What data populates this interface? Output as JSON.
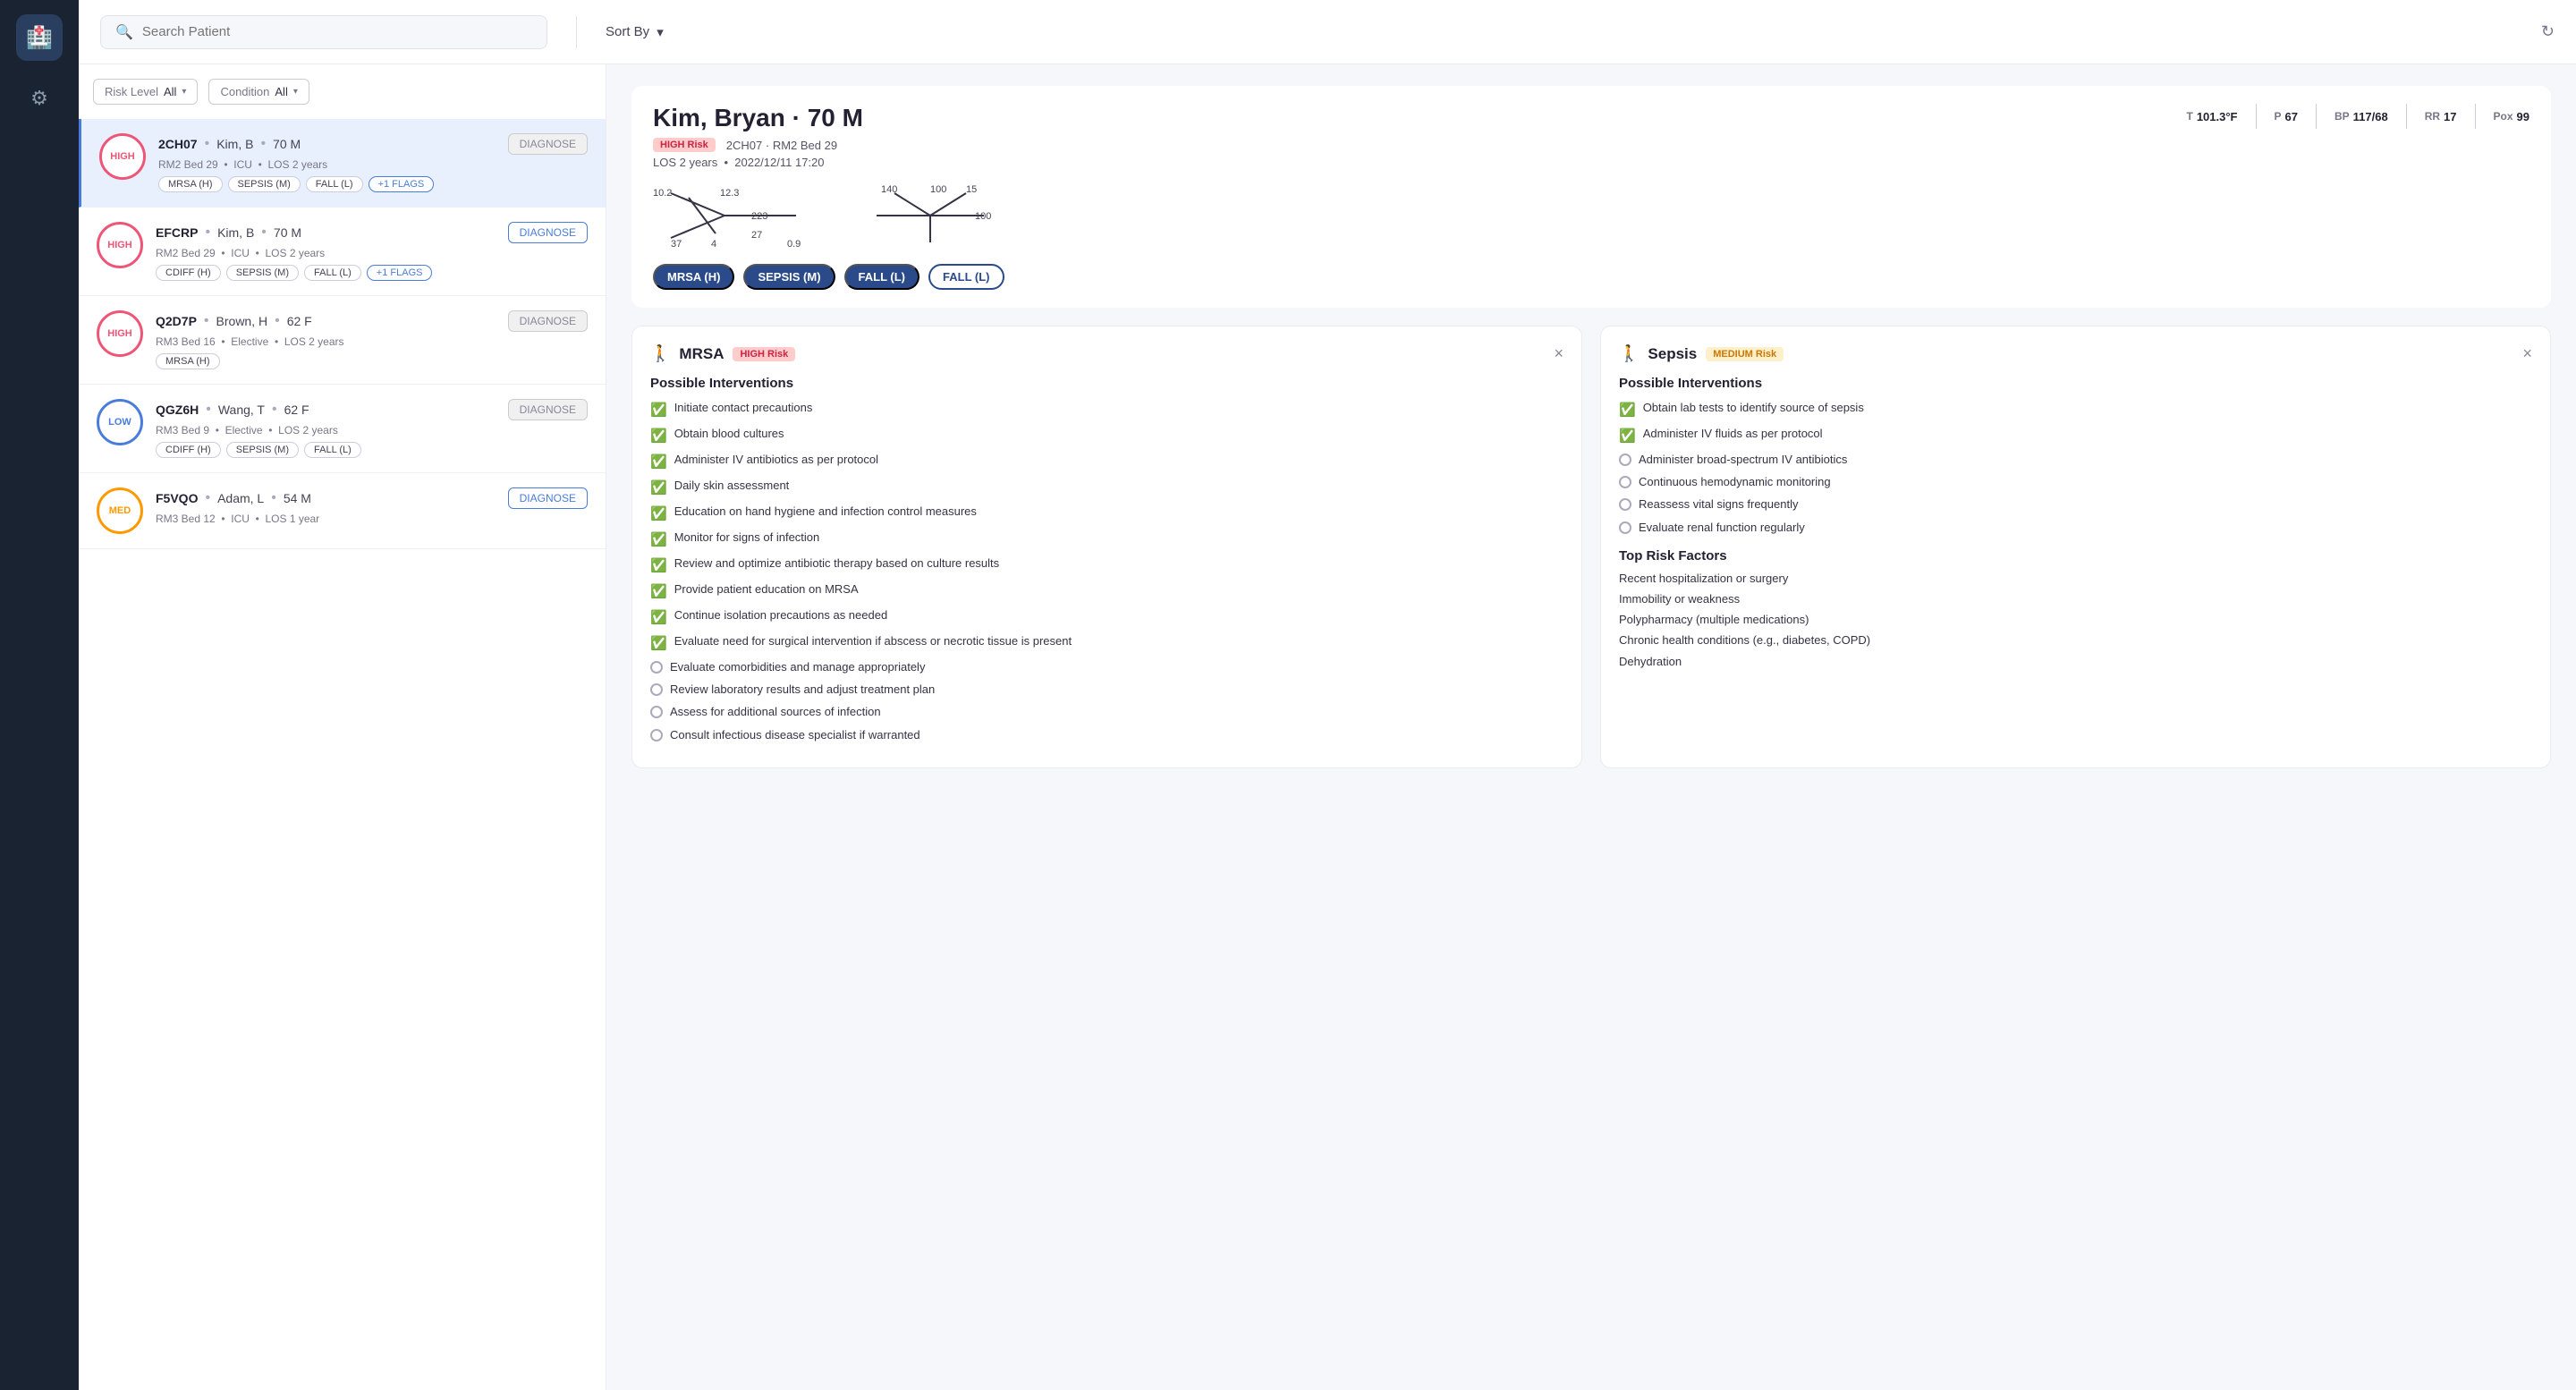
{
  "sidebar": {
    "logo_emoji": "🏥",
    "gear_label": "⚙"
  },
  "topbar": {
    "search_placeholder": "Search Patient",
    "sort_label": "Sort By",
    "refresh_icon": "↻"
  },
  "filters": {
    "risk_label": "Risk Level",
    "risk_value": "All",
    "condition_label": "Condition",
    "condition_value": "All"
  },
  "patients": [
    {
      "id": "2CH07",
      "name": "Kim, B",
      "age": "70 M",
      "risk": "HIGH",
      "ward": "RM2 Bed 29",
      "unit": "ICU",
      "los": "LOS 2 years",
      "tags": [
        "MRSA (H)",
        "SEPSIS (M)",
        "FALL (L)"
      ],
      "extra_tags": "+1 FLAGS",
      "diagnose_label": "DIAGNOSE",
      "selected": true
    },
    {
      "id": "EFCRP",
      "name": "Kim, B",
      "age": "70 M",
      "risk": "HIGH",
      "ward": "RM2 Bed 29",
      "unit": "ICU",
      "los": "LOS 2 years",
      "tags": [
        "CDIFF (H)",
        "SEPSIS (M)",
        "FALL (L)"
      ],
      "extra_tags": "+1 FLAGS",
      "diagnose_label": "DIAGNOSE",
      "selected": false
    },
    {
      "id": "Q2D7P",
      "name": "Brown, H",
      "age": "62 F",
      "risk": "HIGH",
      "ward": "RM3 Bed 16",
      "unit": "Elective",
      "los": "LOS 2 years",
      "tags": [
        "MRSA (H)"
      ],
      "extra_tags": "",
      "diagnose_label": "DIAGNOSE",
      "selected": false
    },
    {
      "id": "QGZ6H",
      "name": "Wang, T",
      "age": "62 F",
      "risk": "LOW",
      "ward": "RM3 Bed 9",
      "unit": "Elective",
      "los": "LOS 2 years",
      "tags": [
        "CDIFF (H)",
        "SEPSIS (M)",
        "FALL (L)"
      ],
      "extra_tags": "",
      "diagnose_label": "DIAGNOSE",
      "selected": false
    },
    {
      "id": "F5VQO",
      "name": "Adam, L",
      "age": "54 M",
      "risk": "MED",
      "ward": "RM3 Bed 12",
      "unit": "ICU",
      "los": "LOS 1 year",
      "tags": [],
      "extra_tags": "",
      "diagnose_label": "DIAGNOSE",
      "selected": false
    }
  ],
  "detail": {
    "patient_name": "Kim, Bryan · 70 M",
    "risk_badge": "HIGH Risk",
    "room": "2CH07 · RM2 Bed 29",
    "los": "LOS 2 years",
    "admit_date": "2022/12/11 17:20",
    "vitals": {
      "t_label": "T",
      "t_val": "101.3°F",
      "p_label": "P",
      "p_val": "67",
      "bp_label": "BP",
      "bp_val": "117/68",
      "rr_label": "RR",
      "rr_val": "17",
      "pox_label": "Pox",
      "pox_val": "99"
    },
    "star1": {
      "top_left": "10.2",
      "top_center": "12.3",
      "top_right": "",
      "center": "223",
      "bottom_left": "37",
      "bottom_center": "4",
      "bottom_right": "27",
      "bottom_far_right": "0.9"
    },
    "star2": {
      "top_left": "",
      "top_center": "140",
      "top_center2": "100",
      "top_right": "15",
      "bottom_left": "",
      "bottom_center": "",
      "bottom_right": "100"
    },
    "conditions": [
      {
        "label": "MRSA (H)",
        "style": "blue"
      },
      {
        "label": "SEPSIS (M)",
        "style": "blue"
      },
      {
        "label": "FALL (L)",
        "style": "blue"
      },
      {
        "label": "FALL (L)",
        "style": "outline"
      }
    ]
  },
  "mrsa_card": {
    "icon": "🚶",
    "title": "MRSA",
    "risk_label": "HIGH Risk",
    "close_label": "×",
    "interventions_title": "Possible Interventions",
    "items": [
      {
        "text": "Initiate contact precautions",
        "checked": true
      },
      {
        "text": "Obtain blood cultures",
        "checked": true
      },
      {
        "text": "Administer IV antibiotics as per protocol",
        "checked": true
      },
      {
        "text": "Daily skin assessment",
        "checked": true
      },
      {
        "text": "Education on hand hygiene and infection control measures",
        "checked": true
      },
      {
        "text": "Monitor for signs of infection",
        "checked": true
      },
      {
        "text": "Review and optimize antibiotic therapy based on culture results",
        "checked": true
      },
      {
        "text": "Provide patient education on MRSA",
        "checked": true
      },
      {
        "text": "Continue isolation precautions as needed",
        "checked": true
      },
      {
        "text": "Evaluate need for surgical intervention if abscess or necrotic tissue is present",
        "checked": true
      },
      {
        "text": "Evaluate comorbidities and manage appropriately",
        "checked": false
      },
      {
        "text": "Review laboratory results and adjust treatment plan",
        "checked": false
      },
      {
        "text": "Assess for additional sources of infection",
        "checked": false
      },
      {
        "text": "Consult infectious disease specialist if warranted",
        "checked": false
      }
    ]
  },
  "sepsis_card": {
    "icon": "🚶",
    "title": "Sepsis",
    "risk_label": "MEDIUM Risk",
    "close_label": "×",
    "interventions_title": "Possible Interventions",
    "items": [
      {
        "text": "Obtain lab tests to identify source of sepsis",
        "checked": true
      },
      {
        "text": "Administer IV fluids as per protocol",
        "checked": true
      },
      {
        "text": "Administer broad-spectrum IV antibiotics",
        "checked": false
      },
      {
        "text": "Continuous hemodynamic monitoring",
        "checked": false
      },
      {
        "text": "Reassess vital signs frequently",
        "checked": false
      },
      {
        "text": "Evaluate renal function regularly",
        "checked": false
      }
    ],
    "top_risk_title": "Top Risk Factors",
    "risk_factors": [
      "Recent hospitalization or surgery",
      "Immobility or weakness",
      "Polypharmacy (multiple medications)",
      "Chronic health conditions (e.g., diabetes, COPD)",
      "Dehydration"
    ]
  }
}
